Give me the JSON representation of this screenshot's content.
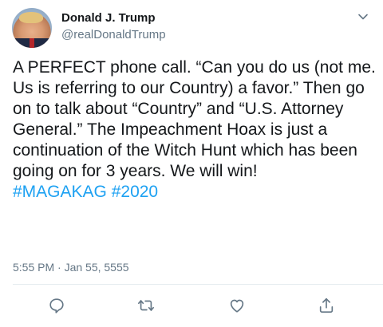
{
  "author": {
    "name": "Donald J. Trump",
    "handle": "@realDonaldTrump"
  },
  "tweet": {
    "text": "A PERFECT phone call. “Can you do us (not me. Us is referring to our Country) a favor.” Then go on to talk about “Country” and “U.S. Attorney General.” The Impeachment Hoax is just a continuation of the Witch Hunt which has been going on for 3 years. We will win!",
    "hashtags": [
      "#MAGAKAG",
      "#2020"
    ],
    "timestamp": "5:55 PM · Jan 55, 5555"
  },
  "actions": {
    "reply_icon": "reply-icon",
    "retweet_icon": "retweet-icon",
    "like_icon": "like-icon",
    "share_icon": "share-icon"
  },
  "colors": {
    "text": "#14171a",
    "secondary": "#657786",
    "link": "#1da1f2",
    "divider": "#e6ecf0"
  }
}
